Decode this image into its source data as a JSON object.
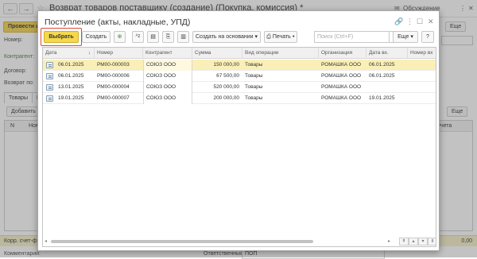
{
  "background": {
    "title": "Возврат товаров поставщику (создание) (Покупка, комиссия) *",
    "discussion_label": "Обсуждение",
    "post_button": "Провести и",
    "labels": {
      "number": "Номер:",
      "counterparty": "Контрагент:",
      "contract": "Договор:",
      "return_from": "Возврат по:",
      "corr_invoice": "Корр. счет-фа",
      "comment": "Комментарий:",
      "responsible": "Ответственный:",
      "responsible_value": "ПОП"
    },
    "tabs": [
      "Товары",
      "Во"
    ],
    "add_button": "Добавить",
    "more_button": "Еще",
    "more_top": "Еще",
    "grid_cols": [
      "N",
      "Ном",
      "чет учета"
    ],
    "total": "0,00"
  },
  "dialog": {
    "title": "Поступление (акты, накладные, УПД)",
    "toolbar": {
      "select": "Выбрать",
      "create": "Создать",
      "create_based_on": "Создать на основании",
      "print": "Печать",
      "search_placeholder": "Поиск (Ctrl+F)",
      "more": "Еще",
      "help": "?"
    },
    "columns": [
      "Дата",
      "Номер",
      "Контрагент",
      "Сумма",
      "Вид операции",
      "Организация",
      "Дата вх.",
      "Номер вх"
    ],
    "rows": [
      {
        "date": "06.01.2025",
        "number": "РМ00-000003",
        "counterparty": "СОЮЗ ООО",
        "sum": "150 000,00",
        "operation": "Товары",
        "org": "РОМАШКА ООО",
        "in_date": "06.01.2025",
        "in_number": "",
        "selected": true
      },
      {
        "date": "06.01.2025",
        "number": "РМ00-000006",
        "counterparty": "СОЮЗ ООО",
        "sum": "67 500,00",
        "operation": "Товары",
        "org": "РОМАШКА ООО",
        "in_date": "06.01.2025",
        "in_number": "",
        "selected": false
      },
      {
        "date": "13.01.2025",
        "number": "РМ00-000004",
        "counterparty": "СОЮЗ ООО",
        "sum": "520 000,00",
        "operation": "Товары",
        "org": "РОМАШКА ООО",
        "in_date": "",
        "in_number": "",
        "selected": false
      },
      {
        "date": "19.01.2025",
        "number": "РМ00-000007",
        "counterparty": "СОЮЗ ООО",
        "sum": "200 000,00",
        "operation": "Товары",
        "org": "РОМАШКА ООО",
        "in_date": "19.01.2025",
        "in_number": "",
        "selected": false
      }
    ]
  },
  "colors": {
    "accent_yellow": "#f6d84c",
    "selected_row": "#f9efb7",
    "highlight_ring": "#e0443a"
  }
}
